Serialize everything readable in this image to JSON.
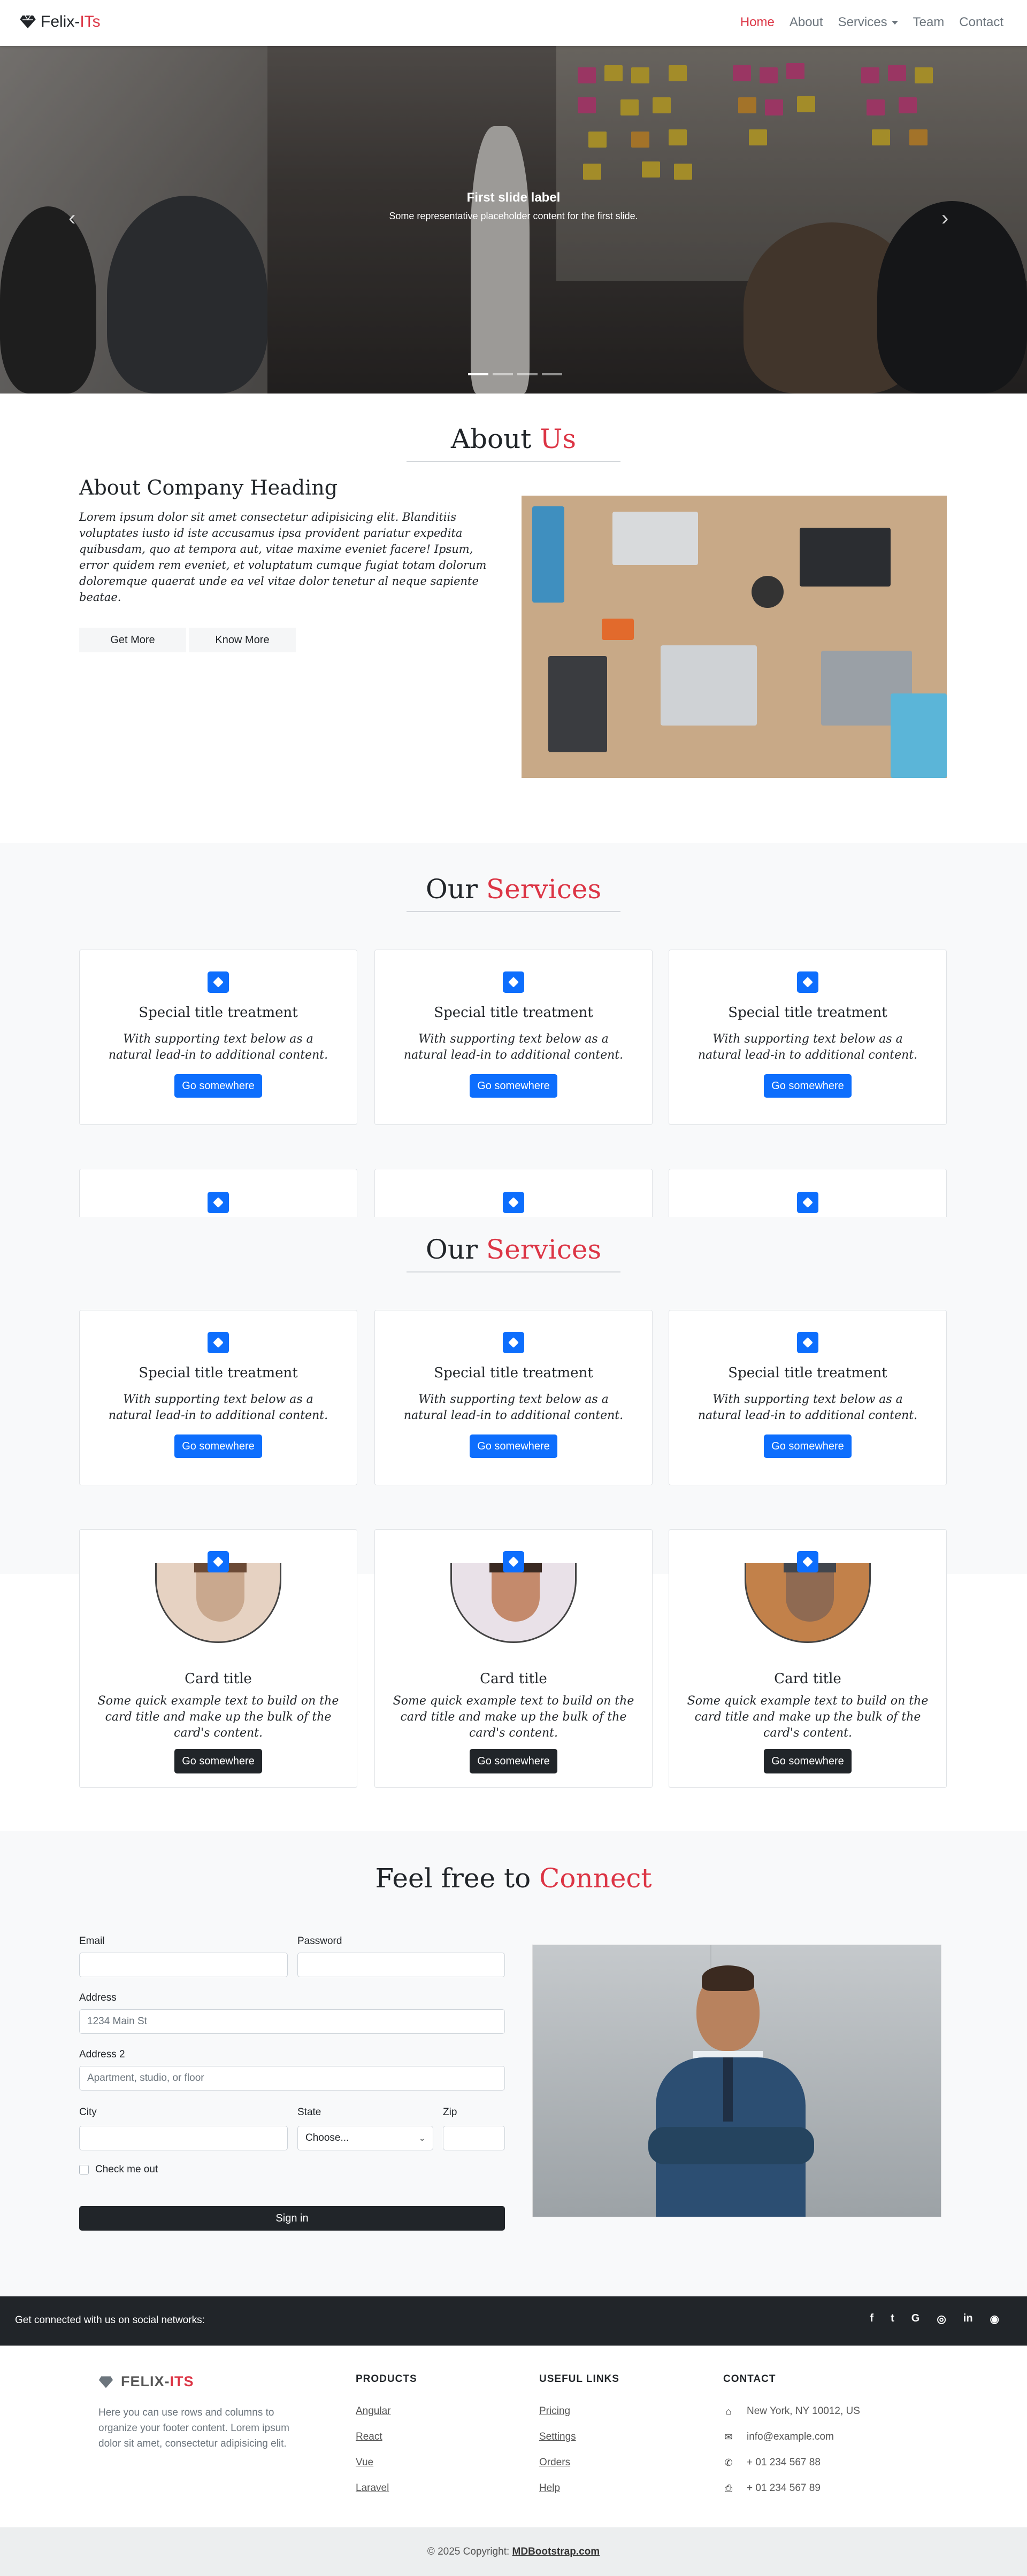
{
  "nav": {
    "brand": "Felix-",
    "brand_accent": "ITs",
    "items": [
      "Home",
      "About",
      "Services",
      "Team",
      "Contact"
    ]
  },
  "hero": {
    "caption_title": "First slide label",
    "caption_text": "Some representative placeholder content for the first slide.",
    "prev_icon": "chevron-left-icon",
    "next_icon": "chevron-right-icon"
  },
  "about": {
    "title": "About",
    "title_accent": "Us",
    "heading": "About Company Heading",
    "body": "Lorem ipsum dolor sit amet consectetur adipisicing elit. Blanditiis voluptates iusto id iste accusamus ipsa provident pariatur expedita quibusdam, quo at tempora aut, vitae maxime eveniet facere! Ipsum, error quidem rem eveniet, et voluptatum cumque fugiat totam dolorum doloremque quaerat unde ea vel vitae dolor tenetur al neque sapiente beatae.",
    "btn_more": "Get More",
    "btn_know": "Know More"
  },
  "services": {
    "title": "Our",
    "title_accent": "Services",
    "card_title": "Special title treatment",
    "card_text": "With supporting text below as a natural lead-in to additional content.",
    "card_btn": "Go somewhere"
  },
  "team": {
    "card_title": "Card title",
    "card_text": "Some quick example text to build on the card title and make up the bulk of the card's content.",
    "card_btn": "Go somewhere"
  },
  "contact": {
    "title": "Feel free to",
    "title_accent": "Connect",
    "email_label": "Email",
    "password_label": "Password",
    "address_label": "Address",
    "address_placeholder": "1234 Main St",
    "address2_label": "Address 2",
    "address2_placeholder": "Apartment, studio, or floor",
    "city_label": "City",
    "state_label": "State",
    "state_value": "Choose...",
    "zip_label": "Zip",
    "check_label": "Check me out",
    "submit": "Sign in"
  },
  "social": {
    "text": "Get connected with us on social networks:",
    "icons": [
      "facebook-icon",
      "twitter-icon",
      "google-icon",
      "instagram-icon",
      "linkedin-icon",
      "github-icon"
    ],
    "glyphs": [
      "f",
      "t",
      "G",
      "◎",
      "in",
      "◉"
    ]
  },
  "footer": {
    "brand": "FELIX-",
    "brand_accent": "ITS",
    "blurb": "Here you can use rows and columns to organize your footer content. Lorem ipsum dolor sit amet, consectetur adipisicing elit.",
    "products_head": "PRODUCTS",
    "products": [
      "Angular",
      "React",
      "Vue",
      "Laravel"
    ],
    "links_head": "USEFUL LINKS",
    "links": [
      "Pricing",
      "Settings",
      "Orders",
      "Help"
    ],
    "contact_head": "CONTACT",
    "contact": [
      "New York, NY 10012, US",
      "info@example.com",
      "+ 01 234 567 88",
      "+ 01 234 567 89"
    ],
    "copyright": "© 2025 Copyright:",
    "copyright_link": "MDBootstrap.com"
  }
}
